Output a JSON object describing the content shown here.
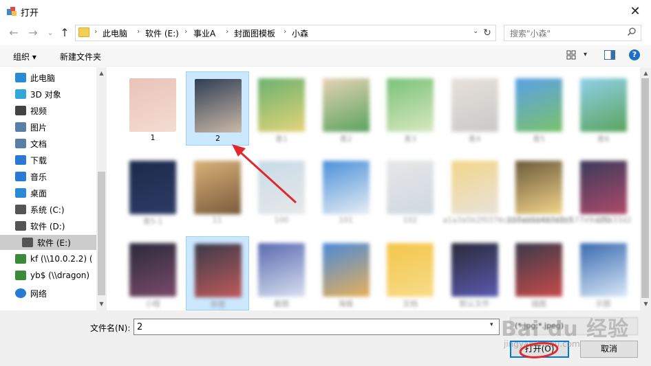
{
  "window": {
    "title": "打开",
    "close": "✕"
  },
  "nav": {
    "back": "←",
    "forward": "→",
    "recent": "⌄",
    "up": "↑",
    "breadcrumbs": [
      "此电脑",
      "软件 (E:)",
      "事业A",
      "封面图模板",
      "小森"
    ],
    "separator": "›",
    "dropdown": "⌄",
    "refresh": "↻",
    "search_placeholder": "搜索\"小森\""
  },
  "toolbar": {
    "organize": "组织 ▾",
    "new_folder": "新建文件夹",
    "view_dropdown": "▾",
    "help": "?"
  },
  "sidebar": {
    "items": [
      {
        "label": "此电脑",
        "icon": "computer-icon",
        "color": "#2a8ad4"
      },
      {
        "label": "3D 对象",
        "icon": "cube-icon",
        "color": "#34a7d9"
      },
      {
        "label": "视频",
        "icon": "film-icon",
        "color": "#444444"
      },
      {
        "label": "图片",
        "icon": "picture-icon",
        "color": "#5a7fa6"
      },
      {
        "label": "文档",
        "icon": "document-icon",
        "color": "#5a7fa6"
      },
      {
        "label": "下载",
        "icon": "download-icon",
        "color": "#2a7ad4"
      },
      {
        "label": "音乐",
        "icon": "music-icon",
        "color": "#2a7ad4"
      },
      {
        "label": "桌面",
        "icon": "desktop-icon",
        "color": "#2a8ad4"
      },
      {
        "label": "系统 (C:)",
        "icon": "system-drive-icon",
        "color": "#555555"
      },
      {
        "label": "软件 (D:)",
        "icon": "drive-icon",
        "color": "#555555"
      },
      {
        "label": "软件 (E:)",
        "icon": "drive-icon",
        "color": "#555555",
        "selected": true
      },
      {
        "label": "kf (\\\\10.0.2.2) (",
        "icon": "network-drive-icon",
        "color": "#3a8a3a"
      },
      {
        "label": "yb$ (\\\\dragon)",
        "icon": "network-drive-icon",
        "color": "#3a8a3a"
      },
      {
        "label": "网络",
        "icon": "network-icon",
        "color": "#2a7ad4"
      }
    ],
    "scroll_up": "▲",
    "scroll_down": "▼"
  },
  "files": [
    {
      "label": "1",
      "blurred": false,
      "c1": "#e9c3b8",
      "c2": "#f4dcd3"
    },
    {
      "label": "2",
      "blurred": false,
      "selected": true,
      "c1": "#2f3e55",
      "c2": "#cbb9a7"
    },
    {
      "label": "青1",
      "blurred": true,
      "c1": "#6bb26e",
      "c2": "#e4d47a"
    },
    {
      "label": "青2",
      "blurred": true,
      "c1": "#e6d2b4",
      "c2": "#5aa45e"
    },
    {
      "label": "青3",
      "blurred": true,
      "c1": "#7ac27a",
      "c2": "#d8e8c0"
    },
    {
      "label": "青4",
      "blurred": true,
      "c1": "#e7e1da",
      "c2": "#c9c9c9"
    },
    {
      "label": "青5",
      "blurred": true,
      "c1": "#5aa0e8",
      "c2": "#7ac26a"
    },
    {
      "label": "青6",
      "blurred": true,
      "c1": "#8fd0e8",
      "c2": "#5aa45e"
    },
    {
      "label": "青5-1",
      "blurred": true,
      "c1": "#1b2a4a",
      "c2": "#2e3c66"
    },
    {
      "label": "11",
      "blurred": true,
      "c1": "#d9b27a",
      "c2": "#7a5a3a"
    },
    {
      "label": "100",
      "blurred": true,
      "c1": "#c7dbe8",
      "c2": "#e8e8e8"
    },
    {
      "label": "101",
      "blurred": true,
      "c1": "#4a90d8",
      "c2": "#e8eef5"
    },
    {
      "label": "102",
      "blurred": true,
      "c1": "#e6e6e6",
      "c2": "#cfd8e2"
    },
    {
      "label": "a1a3a5b2f0376c2b8ebad4a7a1c5",
      "blurred": true,
      "c1": "#f3d68a",
      "c2": "#e8e2da"
    },
    {
      "label": "b37ad5b48d48b577e9ad5a33d2",
      "blurred": true,
      "c1": "#6a5a3a",
      "c2": "#f3d48a"
    },
    {
      "label": "100",
      "blurred": true,
      "c1": "#3a3a5a",
      "c2": "#b04a6a"
    },
    {
      "label": "小程",
      "blurred": true,
      "c1": "#2a2a3a",
      "c2": "#7a4a6a"
    },
    {
      "label": "原图",
      "blurred": true,
      "c1": "#3a3a4a",
      "c2": "#c05a5a",
      "selected": true
    },
    {
      "label": "截图",
      "blurred": true,
      "c1": "#5a6ab0",
      "c2": "#d8e0f0"
    },
    {
      "label": "海报",
      "blurred": true,
      "c1": "#4a8ad8",
      "c2": "#e8b05a"
    },
    {
      "label": "文档",
      "blurred": true,
      "c1": "#f3c64a",
      "c2": "#f8dc8a"
    },
    {
      "label": "默认文件",
      "blurred": true,
      "c1": "#2a2a3a",
      "c2": "#5a5ab0"
    },
    {
      "label": "插图",
      "blurred": true,
      "c1": "#3a3a4a",
      "c2": "#c84a4a"
    },
    {
      "label": "示图",
      "blurred": true,
      "c1": "#3a6ab0",
      "c2": "#d8e8f8"
    }
  ],
  "bottom": {
    "filename_label": "文件名(N):",
    "filename_value": "2",
    "filename_dropdown": "▾",
    "filter_value": "(*.jpg;*.jpeg)",
    "open_button": "打开(O)",
    "cancel_button": "取消"
  },
  "watermark": {
    "text": "Bai du 经验",
    "sub": "jingyan.baidu.com"
  }
}
